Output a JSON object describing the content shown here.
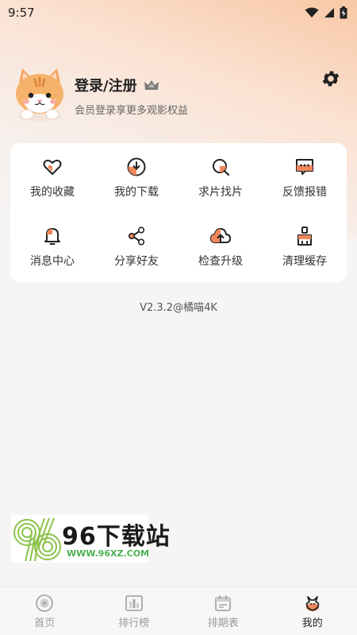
{
  "status_bar": {
    "time": "9:57"
  },
  "profile": {
    "login_label": "登录/注册",
    "subtitle": "会员登录享更多观影权益"
  },
  "menu": {
    "items": [
      {
        "label": "我的收藏",
        "icon": "heart-icon"
      },
      {
        "label": "我的下载",
        "icon": "download-icon"
      },
      {
        "label": "求片找片",
        "icon": "search-movie-icon"
      },
      {
        "label": "反馈报错",
        "icon": "feedback-icon"
      },
      {
        "label": "消息中心",
        "icon": "bell-icon"
      },
      {
        "label": "分享好友",
        "icon": "share-icon"
      },
      {
        "label": "检查升级",
        "icon": "upgrade-icon"
      },
      {
        "label": "清理缓存",
        "icon": "broom-icon"
      }
    ]
  },
  "version": "V2.3.2@橘喵4K",
  "watermark": {
    "brand": "96下载站",
    "url": "WWW.96XZ.COM"
  },
  "bottom_nav": {
    "items": [
      {
        "label": "首页",
        "icon": "home-icon"
      },
      {
        "label": "排行榜",
        "icon": "ranking-icon"
      },
      {
        "label": "排期表",
        "icon": "schedule-icon"
      },
      {
        "label": "我的",
        "icon": "profile-icon"
      }
    ],
    "active_index": 3
  },
  "colors": {
    "accent": "#f0875a",
    "text": "#222222",
    "muted": "#9a9a9a"
  }
}
